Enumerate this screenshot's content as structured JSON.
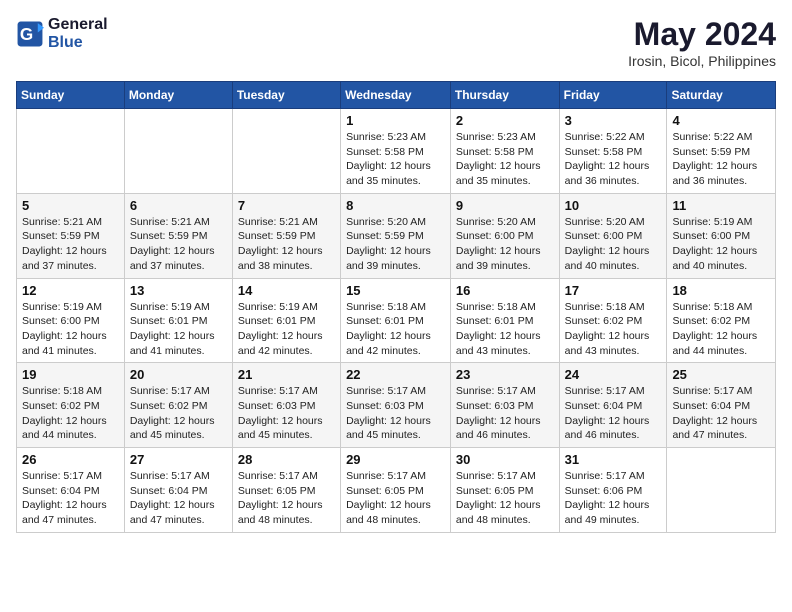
{
  "header": {
    "logo_line1": "General",
    "logo_line2": "Blue",
    "month_year": "May 2024",
    "location": "Irosin, Bicol, Philippines"
  },
  "weekdays": [
    "Sunday",
    "Monday",
    "Tuesday",
    "Wednesday",
    "Thursday",
    "Friday",
    "Saturday"
  ],
  "weeks": [
    [
      null,
      null,
      null,
      {
        "day": 1,
        "sunrise": "5:23 AM",
        "sunset": "5:58 PM",
        "daylight": "12 hours and 35 minutes."
      },
      {
        "day": 2,
        "sunrise": "5:23 AM",
        "sunset": "5:58 PM",
        "daylight": "12 hours and 35 minutes."
      },
      {
        "day": 3,
        "sunrise": "5:22 AM",
        "sunset": "5:58 PM",
        "daylight": "12 hours and 36 minutes."
      },
      {
        "day": 4,
        "sunrise": "5:22 AM",
        "sunset": "5:59 PM",
        "daylight": "12 hours and 36 minutes."
      }
    ],
    [
      {
        "day": 5,
        "sunrise": "5:21 AM",
        "sunset": "5:59 PM",
        "daylight": "12 hours and 37 minutes."
      },
      {
        "day": 6,
        "sunrise": "5:21 AM",
        "sunset": "5:59 PM",
        "daylight": "12 hours and 37 minutes."
      },
      {
        "day": 7,
        "sunrise": "5:21 AM",
        "sunset": "5:59 PM",
        "daylight": "12 hours and 38 minutes."
      },
      {
        "day": 8,
        "sunrise": "5:20 AM",
        "sunset": "5:59 PM",
        "daylight": "12 hours and 39 minutes."
      },
      {
        "day": 9,
        "sunrise": "5:20 AM",
        "sunset": "6:00 PM",
        "daylight": "12 hours and 39 minutes."
      },
      {
        "day": 10,
        "sunrise": "5:20 AM",
        "sunset": "6:00 PM",
        "daylight": "12 hours and 40 minutes."
      },
      {
        "day": 11,
        "sunrise": "5:19 AM",
        "sunset": "6:00 PM",
        "daylight": "12 hours and 40 minutes."
      }
    ],
    [
      {
        "day": 12,
        "sunrise": "5:19 AM",
        "sunset": "6:00 PM",
        "daylight": "12 hours and 41 minutes."
      },
      {
        "day": 13,
        "sunrise": "5:19 AM",
        "sunset": "6:01 PM",
        "daylight": "12 hours and 41 minutes."
      },
      {
        "day": 14,
        "sunrise": "5:19 AM",
        "sunset": "6:01 PM",
        "daylight": "12 hours and 42 minutes."
      },
      {
        "day": 15,
        "sunrise": "5:18 AM",
        "sunset": "6:01 PM",
        "daylight": "12 hours and 42 minutes."
      },
      {
        "day": 16,
        "sunrise": "5:18 AM",
        "sunset": "6:01 PM",
        "daylight": "12 hours and 43 minutes."
      },
      {
        "day": 17,
        "sunrise": "5:18 AM",
        "sunset": "6:02 PM",
        "daylight": "12 hours and 43 minutes."
      },
      {
        "day": 18,
        "sunrise": "5:18 AM",
        "sunset": "6:02 PM",
        "daylight": "12 hours and 44 minutes."
      }
    ],
    [
      {
        "day": 19,
        "sunrise": "5:18 AM",
        "sunset": "6:02 PM",
        "daylight": "12 hours and 44 minutes."
      },
      {
        "day": 20,
        "sunrise": "5:17 AM",
        "sunset": "6:02 PM",
        "daylight": "12 hours and 45 minutes."
      },
      {
        "day": 21,
        "sunrise": "5:17 AM",
        "sunset": "6:03 PM",
        "daylight": "12 hours and 45 minutes."
      },
      {
        "day": 22,
        "sunrise": "5:17 AM",
        "sunset": "6:03 PM",
        "daylight": "12 hours and 45 minutes."
      },
      {
        "day": 23,
        "sunrise": "5:17 AM",
        "sunset": "6:03 PM",
        "daylight": "12 hours and 46 minutes."
      },
      {
        "day": 24,
        "sunrise": "5:17 AM",
        "sunset": "6:04 PM",
        "daylight": "12 hours and 46 minutes."
      },
      {
        "day": 25,
        "sunrise": "5:17 AM",
        "sunset": "6:04 PM",
        "daylight": "12 hours and 47 minutes."
      }
    ],
    [
      {
        "day": 26,
        "sunrise": "5:17 AM",
        "sunset": "6:04 PM",
        "daylight": "12 hours and 47 minutes."
      },
      {
        "day": 27,
        "sunrise": "5:17 AM",
        "sunset": "6:04 PM",
        "daylight": "12 hours and 47 minutes."
      },
      {
        "day": 28,
        "sunrise": "5:17 AM",
        "sunset": "6:05 PM",
        "daylight": "12 hours and 48 minutes."
      },
      {
        "day": 29,
        "sunrise": "5:17 AM",
        "sunset": "6:05 PM",
        "daylight": "12 hours and 48 minutes."
      },
      {
        "day": 30,
        "sunrise": "5:17 AM",
        "sunset": "6:05 PM",
        "daylight": "12 hours and 48 minutes."
      },
      {
        "day": 31,
        "sunrise": "5:17 AM",
        "sunset": "6:06 PM",
        "daylight": "12 hours and 49 minutes."
      },
      null
    ]
  ],
  "labels": {
    "sunrise": "Sunrise:",
    "sunset": "Sunset:",
    "daylight": "Daylight:"
  }
}
